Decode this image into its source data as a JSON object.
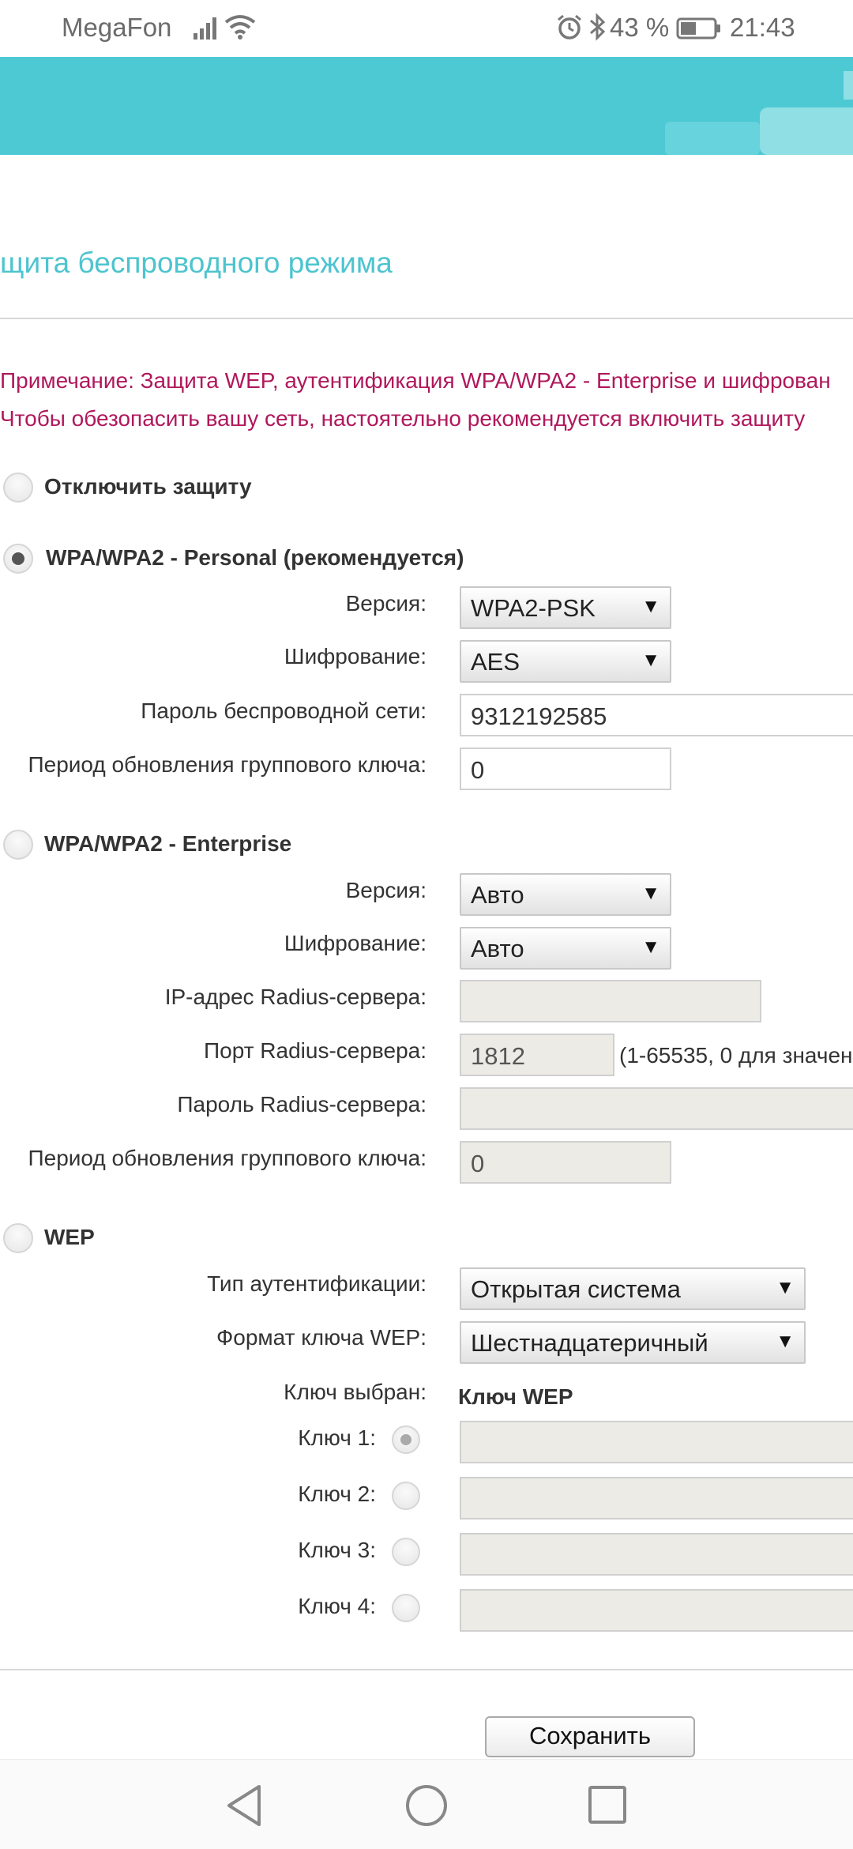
{
  "status_bar": {
    "carrier": "MegaFon",
    "battery_percent": "43 %",
    "time": "21:43",
    "icons": [
      "signal-icon",
      "wifi-icon",
      "alarm-icon",
      "bluetooth-icon",
      "battery-icon"
    ]
  },
  "page": {
    "section_title": "щита беспроводного режима",
    "note_line1": "Примечание: Защита WEP, аутентификация WPA/WPA2 - Enterprise и шифрован",
    "note_line2": "Чтобы обезопасить вашу сеть, настоятельно рекомендуется включить защиту"
  },
  "security": {
    "disable": {
      "label": "Отключить защиту",
      "selected": false
    },
    "personal": {
      "label": "WPA/WPA2 - Personal (рекомендуется)",
      "selected": true,
      "version_label": "Версия:",
      "version_value": "WPA2-PSK",
      "encryption_label": "Шифрование:",
      "encryption_value": "AES",
      "password_label": "Пароль беспроводной сети:",
      "password_value": "9312192585",
      "group_key_label": "Период обновления группового ключа:",
      "group_key_value": "0"
    },
    "enterprise": {
      "label": "WPA/WPA2 - Enterprise",
      "selected": false,
      "version_label": "Версия:",
      "version_value": "Авто",
      "encryption_label": "Шифрование:",
      "encryption_value": "Авто",
      "radius_ip_label": "IP-адрес Radius-сервера:",
      "radius_ip_value": "",
      "radius_port_label": "Порт Radius-сервера:",
      "radius_port_value": "1812",
      "radius_port_hint": "(1-65535, 0 для значен",
      "radius_password_label": "Пароль Radius-сервера:",
      "radius_password_value": "",
      "group_key_label": "Период обновления группового ключа:",
      "group_key_value": "0"
    },
    "wep": {
      "label": "WEP",
      "selected": false,
      "auth_type_label": "Тип аутентификации:",
      "auth_type_value": "Открытая система",
      "key_format_label": "Формат ключа WEP:",
      "key_format_value": "Шестнадцатеричный",
      "key_selected_label": "Ключ выбран:",
      "key_selected_value": "Ключ WEP",
      "keys": [
        {
          "label": "Ключ 1:",
          "selected": true,
          "value": ""
        },
        {
          "label": "Ключ 2:",
          "selected": false,
          "value": ""
        },
        {
          "label": "Ключ 3:",
          "selected": false,
          "value": ""
        },
        {
          "label": "Ключ 4:",
          "selected": false,
          "value": ""
        }
      ]
    }
  },
  "actions": {
    "save_label": "Сохранить"
  },
  "colors": {
    "banner": "#4dc9d4",
    "title": "#4dc4cf",
    "note": "#b0185c"
  }
}
